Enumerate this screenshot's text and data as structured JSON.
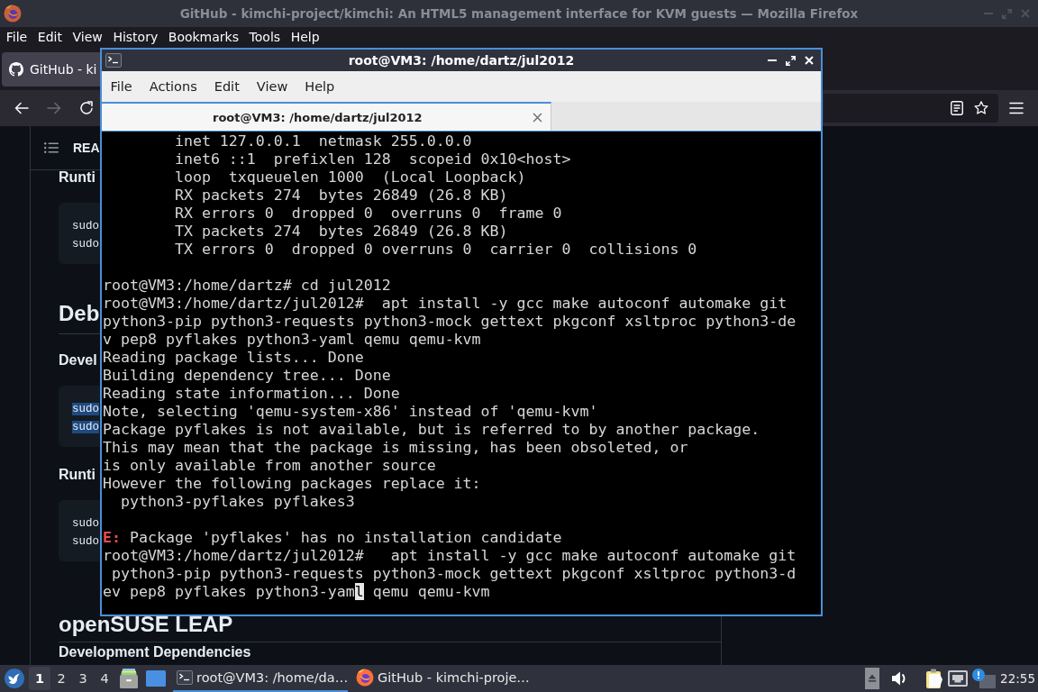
{
  "firefox": {
    "title": "GitHub - kimchi-project/kimchi: An HTML5 management interface for KVM guests — Mozilla Firefox",
    "menu": [
      "File",
      "Edit",
      "View",
      "History",
      "Bookmarks",
      "Tools",
      "Help"
    ],
    "tabs": [
      {
        "label": "GitHub - ki",
        "selected": true
      }
    ],
    "nav_buttons": [
      {
        "kind": "back",
        "disabled": false
      },
      {
        "kind": "forward",
        "disabled": true
      },
      {
        "kind": "reload",
        "disabled": false
      }
    ],
    "readme": {
      "header": "REA",
      "blocks": [
        {
          "kind": "h3",
          "text": "Runti"
        },
        {
          "kind": "code",
          "lines": [
            {
              "text": "sudo",
              "highlighted": false
            },
            {
              "text": "sudo",
              "highlighted": false
            }
          ]
        },
        {
          "kind": "h2",
          "text": "Deb"
        },
        {
          "kind": "h3",
          "text": "Devel"
        },
        {
          "kind": "code",
          "lines": [
            {
              "text": "sudo",
              "highlighted": true
            },
            {
              "text": "sudo",
              "highlighted": true
            }
          ]
        },
        {
          "kind": "h3",
          "text": "Runti"
        },
        {
          "kind": "code",
          "lines": [
            {
              "text": "sudo",
              "highlighted": false
            },
            {
              "text": "sudo",
              "highlighted": false
            }
          ]
        },
        {
          "kind": "h2",
          "text": "openSUSE LEAP"
        },
        {
          "kind": "h3",
          "text": "Development Dependencies"
        }
      ]
    }
  },
  "terminal": {
    "title": "root@VM3: /home/dartz/jul2012",
    "menu": [
      "File",
      "Actions",
      "Edit",
      "View",
      "Help"
    ],
    "tabs": [
      {
        "label": "root@VM3: /home/dartz/jul2012",
        "selected": true
      }
    ],
    "blocks": [
      [
        {
          "kind": "output",
          "text": "        inet 127.0.0.1  netmask 255.0.0.0"
        },
        {
          "kind": "output",
          "text": "        inet6 ::1  prefixlen 128  scopeid 0x10<host>"
        },
        {
          "kind": "output",
          "text": "        loop  txqueuelen 1000  (Local Loopback)"
        },
        {
          "kind": "output",
          "text": "        RX packets 274  bytes 26849 (26.8 KB)"
        },
        {
          "kind": "output",
          "text": "        RX errors 0  dropped 0  overruns 0  frame 0"
        },
        {
          "kind": "output",
          "text": "        TX packets 274  bytes 26849 (26.8 KB)"
        },
        {
          "kind": "output",
          "text": "        TX errors 0  dropped 0 overruns 0  carrier 0  collisions 0"
        }
      ],
      [
        {
          "kind": "output",
          "text": "root@VM3:/home/dartz# cd jul2012"
        },
        {
          "kind": "output",
          "text": "root@VM3:/home/dartz/jul2012#  apt install -y gcc make autoconf automake git"
        },
        {
          "kind": "output",
          "text": "python3-pip python3-requests python3-mock gettext pkgconf xsltproc python3-de"
        },
        {
          "kind": "output",
          "text": "v pep8 pyflakes python3-yaml qemu qemu-kvm"
        },
        {
          "kind": "output",
          "text": "Reading package lists... Done"
        },
        {
          "kind": "output",
          "text": "Building dependency tree... Done"
        },
        {
          "kind": "output",
          "text": "Reading state information... Done"
        },
        {
          "kind": "output",
          "text": "Note, selecting 'qemu-system-x86' instead of 'qemu-kvm'"
        },
        {
          "kind": "output",
          "text": "Package pyflakes is not available, but is referred to by another package."
        },
        {
          "kind": "output",
          "text": "This may mean that the package is missing, has been obsoleted, or"
        },
        {
          "kind": "output",
          "text": "is only available from another source"
        },
        {
          "kind": "output",
          "text": "However the following packages replace it:"
        },
        {
          "kind": "output",
          "text": "  python3-pyflakes pyflakes3"
        }
      ],
      [
        {
          "kind": "error",
          "text": "**E:** Package 'pyflakes' has no installation candidate"
        },
        {
          "kind": "output",
          "text": "root@VM3:/home/dartz/jul2012#   apt install -y gcc make autoconf automake git"
        },
        {
          "kind": "output",
          "text": " python3-pip python3-requests python3-mock gettext pkgconf xsltproc python3-d"
        },
        {
          "kind": "input",
          "text": "ev pep8 pyflakes python3-yam",
          "cursor": "l",
          "rest": " qemu qemu-kvm"
        }
      ]
    ]
  },
  "taskbar": {
    "workspaces": [
      {
        "label": "1",
        "selected": true
      },
      {
        "label": "2",
        "selected": false
      },
      {
        "label": "3",
        "selected": false
      },
      {
        "label": "4",
        "selected": false
      }
    ],
    "tasks": [
      {
        "kind": "terminal",
        "label": "root@VM3: /home/da…",
        "selected": true
      },
      {
        "kind": "browser",
        "label": "GitHub - kimchi-proje…",
        "selected": false
      }
    ],
    "clock": "22:55"
  }
}
